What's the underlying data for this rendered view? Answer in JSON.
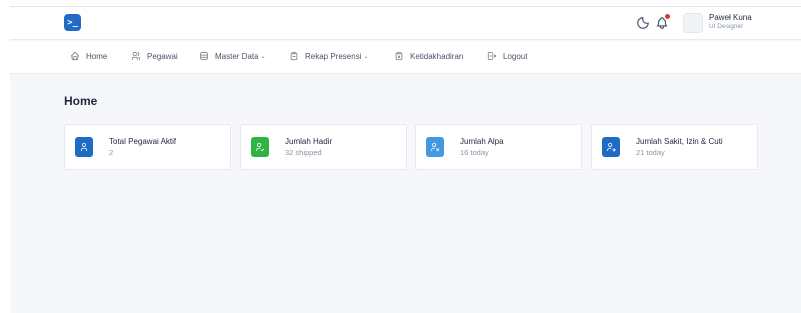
{
  "colors": {
    "primary": "#206bc4",
    "success": "#2fb344",
    "info": "#4299e1",
    "notification_dot": "#d63939"
  },
  "topbar": {
    "logo_icon": "terminal-icon",
    "logo_glyph": ">_",
    "theme_icon": "moon-icon",
    "notification_icon": "bell-icon",
    "user": {
      "name": "Paweł Kuna",
      "role": "UI Designer"
    }
  },
  "nav": {
    "items": [
      {
        "label": "Home",
        "icon": "home-icon",
        "dropdown": false
      },
      {
        "label": "Pegawai",
        "icon": "users-icon",
        "dropdown": false
      },
      {
        "label": "Master Data",
        "icon": "database-icon",
        "dropdown": true
      },
      {
        "label": "Rekap Presensi",
        "icon": "clipboard-icon",
        "dropdown": true
      },
      {
        "label": "Ketidakhadiran",
        "icon": "clipboard-x-icon",
        "dropdown": false
      },
      {
        "label": "Logout",
        "icon": "logout-icon",
        "dropdown": false
      }
    ]
  },
  "page": {
    "title": "Home"
  },
  "cards": [
    {
      "title": "Total Pegawai Aktif",
      "subtitle": "2",
      "icon": "user-icon",
      "color": "#206bc4"
    },
    {
      "title": "Jumlah Hadir",
      "subtitle": "32 shipped",
      "icon": "user-check-icon",
      "color": "#2fb344"
    },
    {
      "title": "Jumlah Alpa",
      "subtitle": "16 today",
      "icon": "user-x-icon",
      "color": "#4299e1"
    },
    {
      "title": "Jumlah Sakit, Izin & Cuti",
      "subtitle": "21 today",
      "icon": "user-arrow-icon",
      "color": "#206bc4"
    }
  ]
}
